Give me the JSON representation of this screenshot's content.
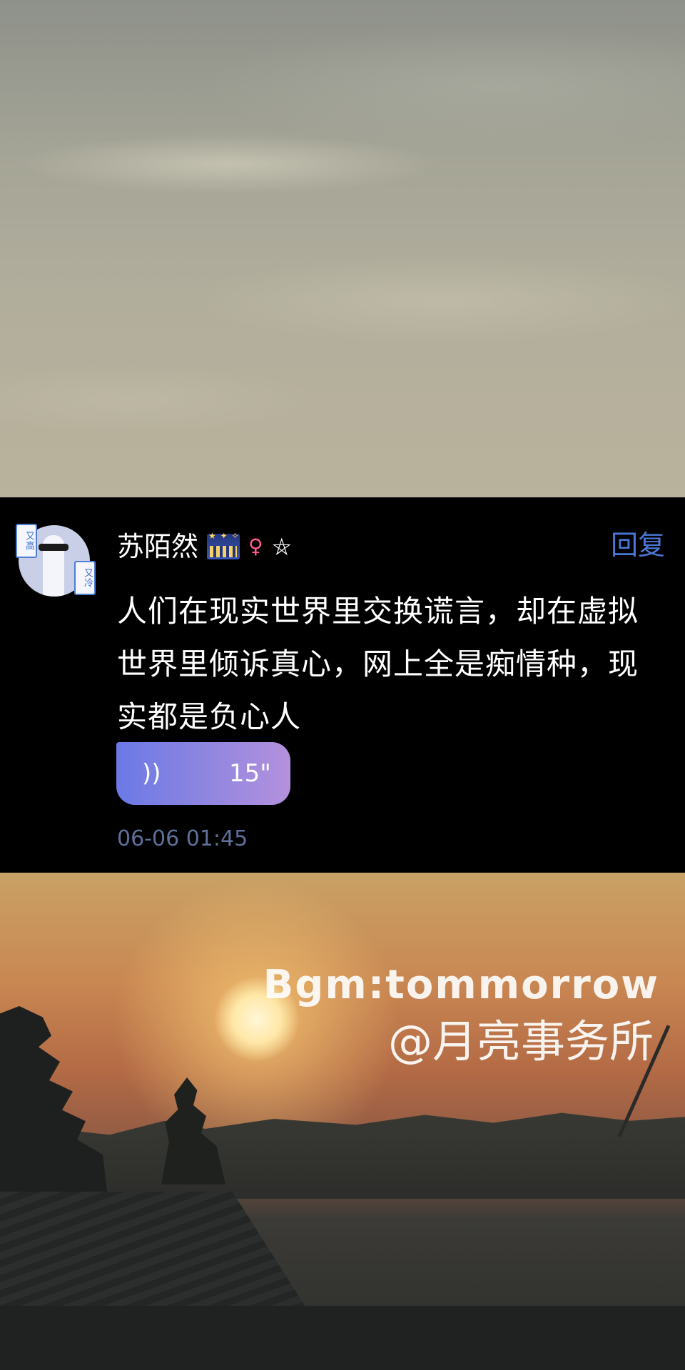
{
  "comment": {
    "avatar_badges": [
      "又高",
      "又冷"
    ],
    "username": "苏陌然",
    "name_icons": {
      "city": "city-night-icon",
      "gender": "♀",
      "vip": "⛤"
    },
    "reply_label": "回复",
    "text": "人们在现实世界里交换谎言，却在虚拟世界里倾诉真心，网上全是痴情种，现实都是负心人",
    "voice": {
      "icon": "))",
      "duration": "15\""
    },
    "timestamp": "06-06 01:45"
  },
  "overlay": {
    "bgm": "Bgm:tommorrow",
    "studio": "@月亮事务所"
  },
  "colors": {
    "accent": "#4a78d8",
    "voice_gradient_start": "#6b79e6",
    "voice_gradient_end": "#b491dd",
    "timestamp": "#5f6f9a"
  }
}
